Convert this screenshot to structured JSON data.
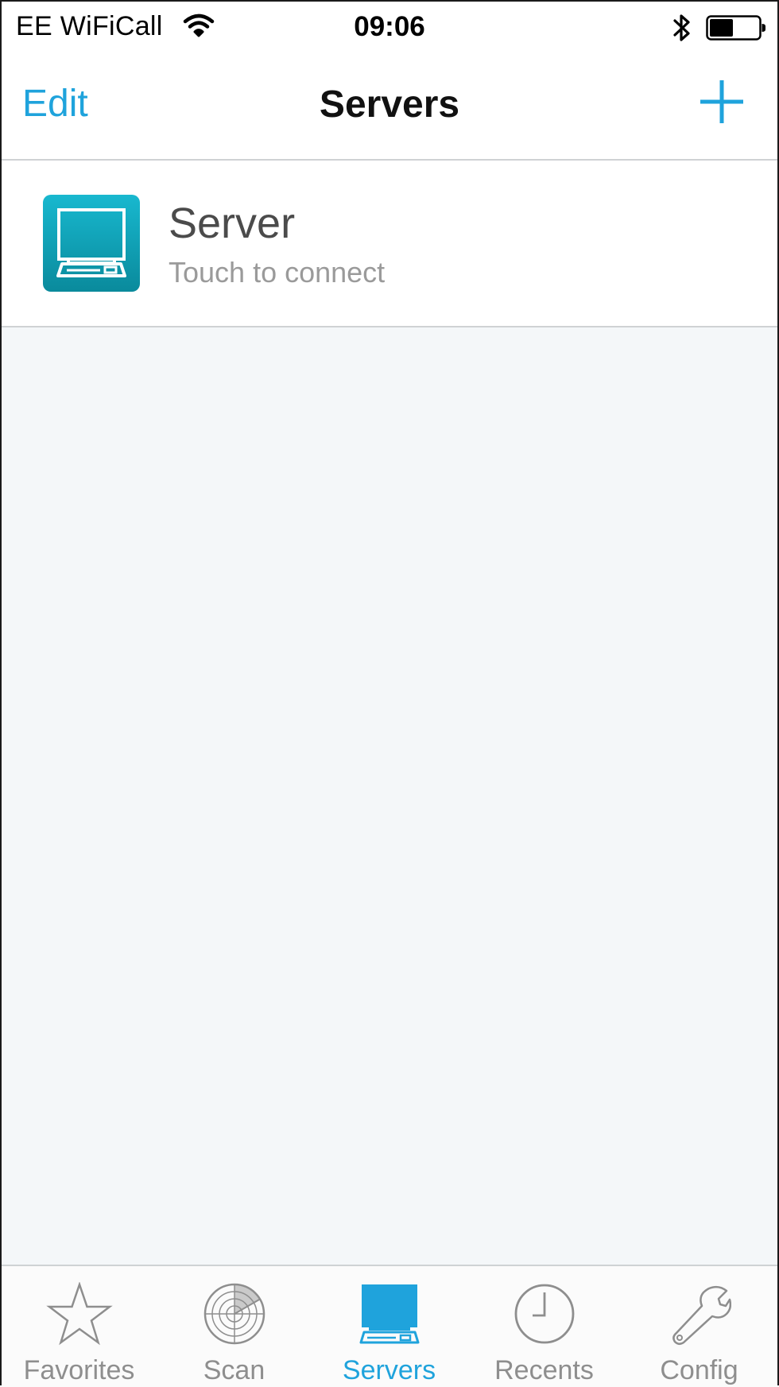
{
  "status_bar": {
    "carrier": "EE WiFiCall",
    "time": "09:06",
    "icons": [
      "wifi-icon",
      "bluetooth-icon",
      "battery-icon"
    ]
  },
  "nav": {
    "edit_label": "Edit",
    "title": "Servers",
    "add_icon": "plus-icon"
  },
  "servers": [
    {
      "name": "Server",
      "subtitle": "Touch to connect",
      "icon": "computer-icon"
    }
  ],
  "tabs": [
    {
      "label": "Favorites",
      "icon": "star-icon",
      "active": false
    },
    {
      "label": "Scan",
      "icon": "radar-icon",
      "active": false
    },
    {
      "label": "Servers",
      "icon": "computer-icon",
      "active": true
    },
    {
      "label": "Recents",
      "icon": "clock-icon",
      "active": false
    },
    {
      "label": "Config",
      "icon": "wrench-icon",
      "active": false
    }
  ],
  "colors": {
    "accent": "#1fa3dc",
    "server_icon_gradient_top": "#18b8cf",
    "server_icon_gradient_bottom": "#0a8a9c",
    "inactive": "#8e8e8e",
    "background": "#f4f7f9"
  }
}
